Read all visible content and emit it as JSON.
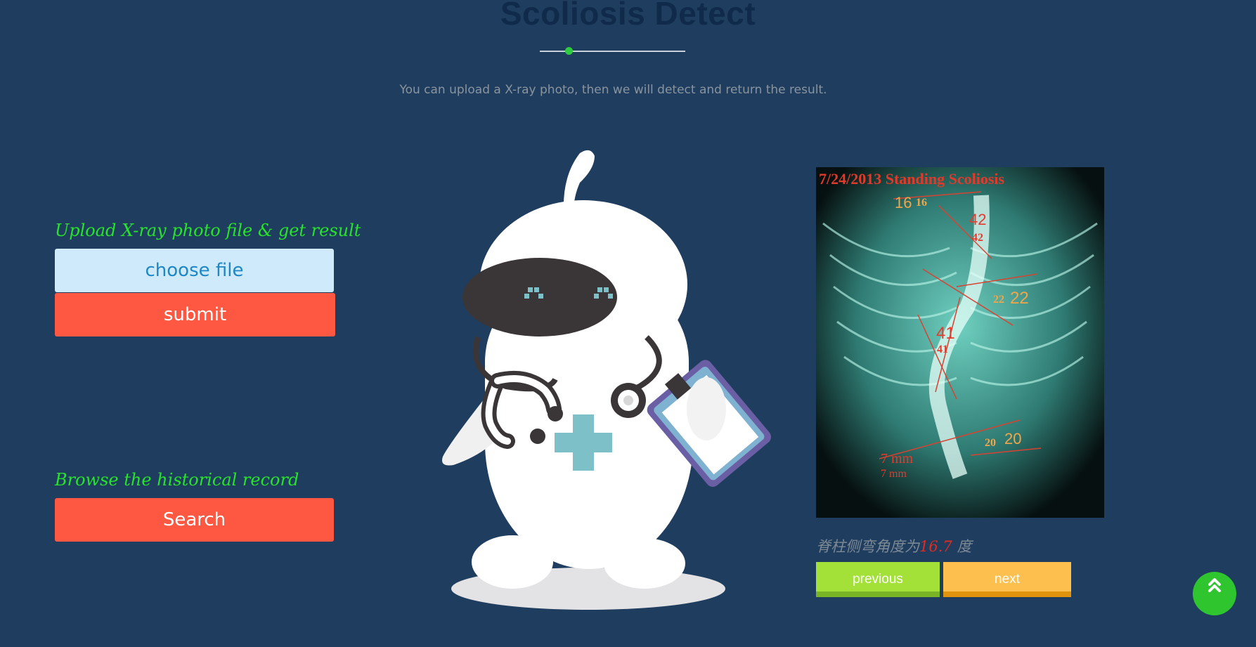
{
  "header": {
    "title": "Scoliosis Detect",
    "subtitle": "You can upload a X-ray photo, then we will detect and return the result."
  },
  "upload": {
    "label": "Upload X-ray photo file & get result",
    "choose_file_label": "choose file",
    "submit_label": "submit"
  },
  "history": {
    "label": "Browse the historical record",
    "search_label": "Search"
  },
  "result": {
    "xray_caption": "7/24/2013 Standing Scoliosis",
    "xray_labels": [
      "16",
      "16",
      "42",
      "42",
      "22",
      "22",
      "41",
      "41",
      "20",
      "20",
      "7 mm",
      "7 mm"
    ],
    "prefix": "脊柱侧弯角度为",
    "angle": "16.7",
    "suffix": "度",
    "previous_label": "previous",
    "next_label": "next"
  },
  "colors": {
    "background": "#1f3d5e",
    "title": "#0f2a4a",
    "label_green": "#27e32b",
    "choose_file_bg": "#cfeafb",
    "submit_bg": "#ff5842",
    "previous_bg": "#a3e038",
    "next_bg": "#fdbf4d",
    "to_top_bg": "#2ec52f",
    "angle_value": "#e52b1e"
  },
  "icons": {
    "to_top": "double-chevron-up-icon"
  }
}
